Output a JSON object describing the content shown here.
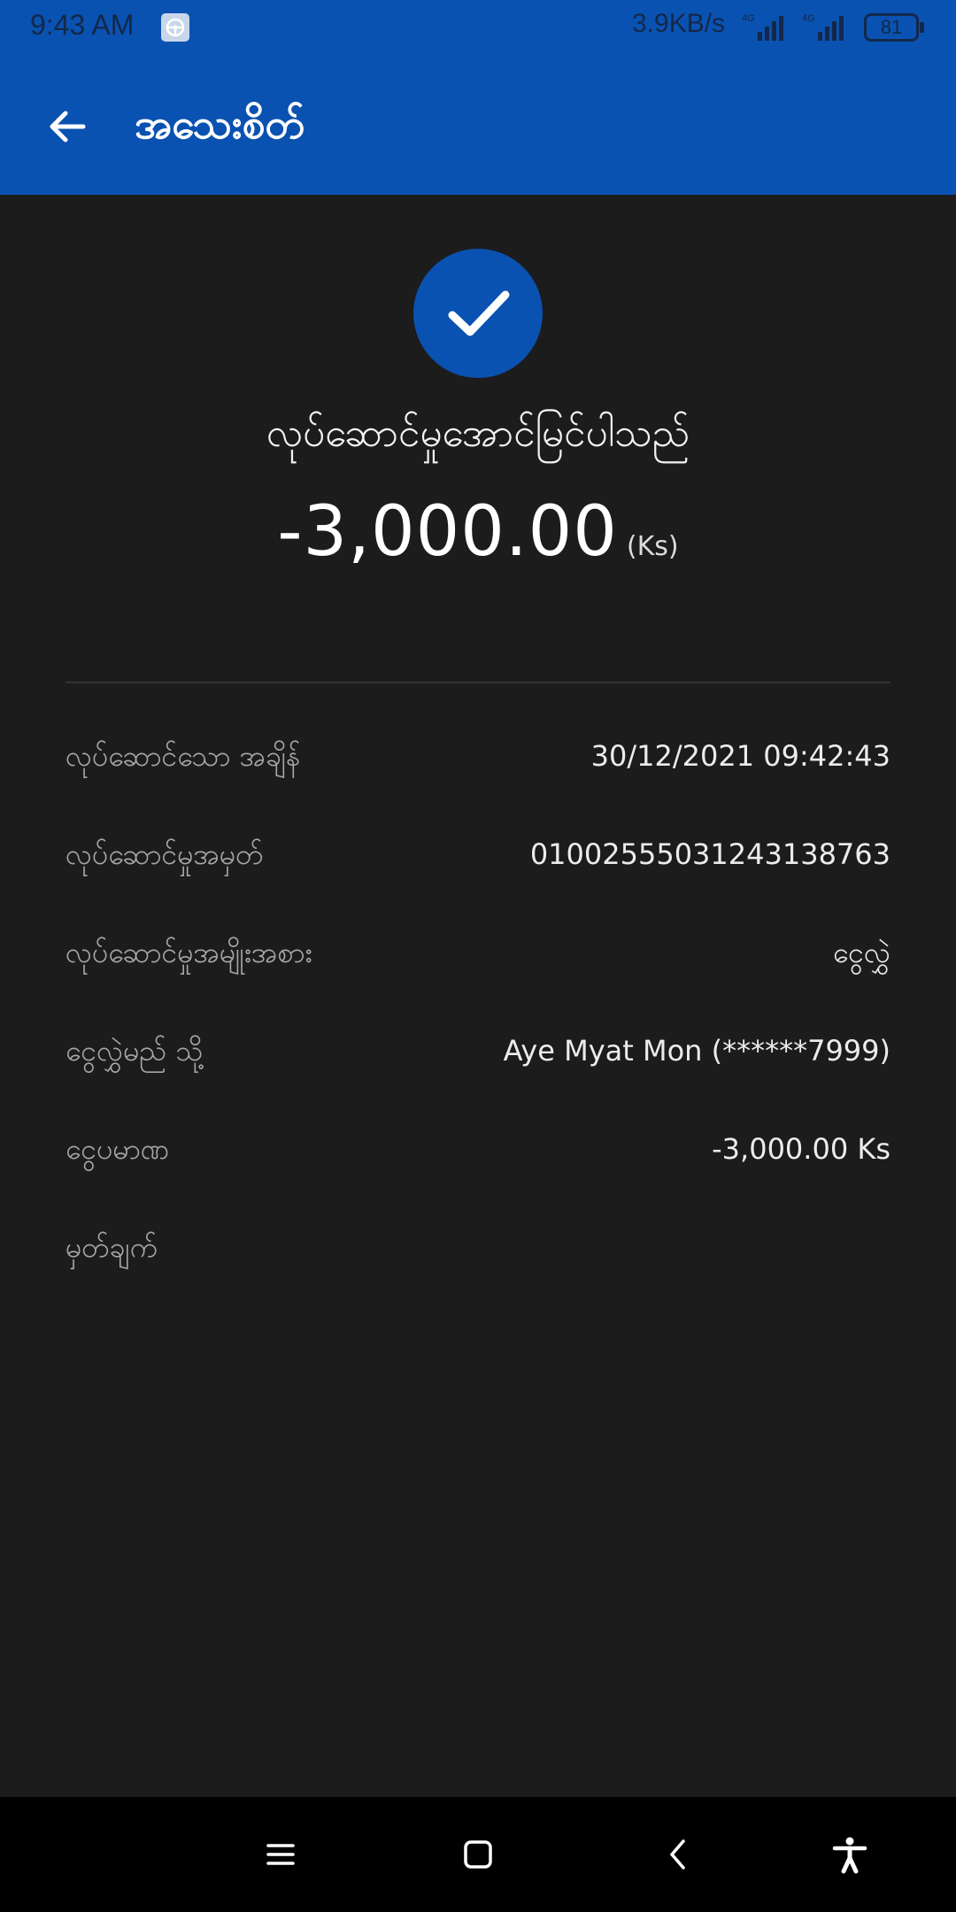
{
  "status_bar": {
    "time": "9:43 AM",
    "network_speed": "3.9KB/s",
    "signal_1_label": "4G",
    "signal_2_label": "4G",
    "battery": "81"
  },
  "app_bar": {
    "title": "အသေးစိတ်"
  },
  "receipt": {
    "status_message": "လုပ်ဆောင်မှုအောင်မြင်ပါသည်",
    "amount": "-3,000.00",
    "amount_unit": "(Ks)"
  },
  "details": [
    {
      "label": "လုပ်ဆောင်သော အချိန်",
      "value": "30/12/2021 09:42:43"
    },
    {
      "label": "လုပ်ဆောင်မှုအမှတ်",
      "value": "01002555031243138763"
    },
    {
      "label": "လုပ်ဆောင်မှုအမျိုးအစား",
      "value": "ငွေလွှဲ"
    },
    {
      "label": "ငွေလွှဲမည် သို့",
      "value": "Aye Myat Mon (******7999)"
    },
    {
      "label": "ငွေပမာဏ",
      "value": "-3,000.00 Ks"
    },
    {
      "label": "မှတ်ချက်",
      "value": ""
    }
  ],
  "icons": {
    "back": "arrow-left-icon",
    "success": "checkmark-icon",
    "nav_menu": "menu-icon",
    "nav_home": "home-square-icon",
    "nav_back": "chevron-left-icon",
    "nav_accessibility": "accessibility-icon"
  },
  "colors": {
    "primary": "#0a52b1",
    "background": "#1c1c1c",
    "nav_background": "#000000"
  }
}
